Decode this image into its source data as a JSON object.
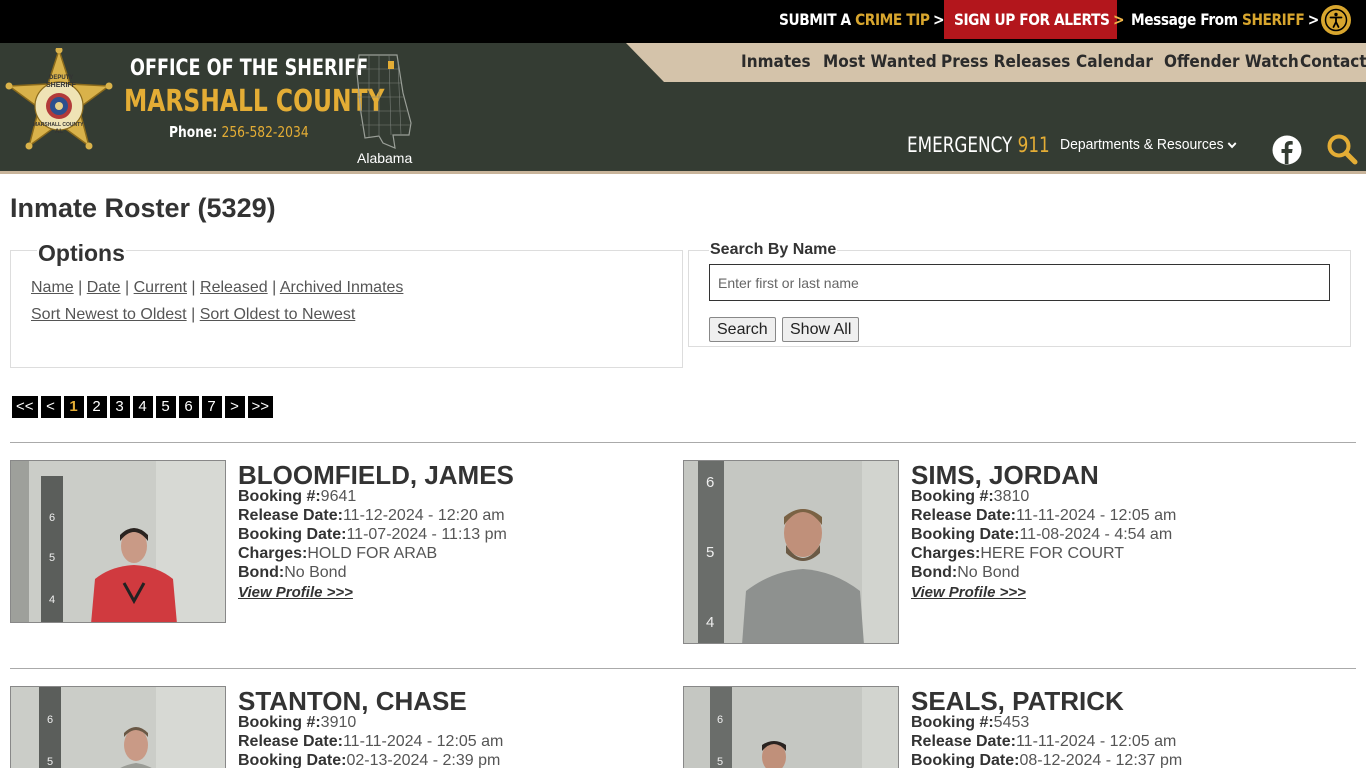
{
  "topbar": {
    "crime_prefix": "SUBMIT A",
    "crime_accent": "CRIME TIP",
    "alerts_label": "SIGN UP FOR ALERTS",
    "message_prefix": "Message From",
    "message_accent": "SHERIFF",
    "chevron": ">",
    "accessibility_icon": "accessibility-icon"
  },
  "header": {
    "office": "OFFICE OF THE SHERIFF",
    "county": "MARSHALL COUNTY",
    "phone_label": "Phone:",
    "phone_number": "256-582-2034",
    "state": "Alabama",
    "badge_text": [
      "DEPUTY",
      "SHERIFF",
      "MARSHALL COUNTY",
      "AL"
    ],
    "nav": [
      "Inmates",
      "Most Wanted",
      "Press Releases",
      "Calendar",
      "Offender Watch",
      "Contact"
    ],
    "emergency_label": "EMERGENCY",
    "emergency_number": "911",
    "departments": "Departments & Resources"
  },
  "page": {
    "title": "Inmate Roster (5329)"
  },
  "options": {
    "legend": "Options",
    "sort_links": [
      "Name",
      "Date",
      "Current",
      "Released",
      "Archived Inmates"
    ],
    "order_links": [
      "Sort Newest to Oldest",
      "Sort Oldest to Newest"
    ],
    "separator": "|"
  },
  "search": {
    "legend": "Search By Name",
    "placeholder": "Enter first or last name",
    "value": "",
    "search_button": "Search",
    "show_all_button": "Show All"
  },
  "pagination": {
    "pages": [
      "<<",
      "<",
      "1",
      "2",
      "3",
      "4",
      "5",
      "6",
      "7",
      ">",
      ">>"
    ],
    "current": "1"
  },
  "labels": {
    "booking_no": "Booking #:",
    "release_date": "Release Date:",
    "booking_date": "Booking Date:",
    "charges": "Charges:",
    "bond": "Bond:",
    "view_profile": "View Profile >>>"
  },
  "inmates": [
    {
      "name": "BLOOMFIELD, JAMES",
      "booking_no": "9641",
      "release_date": "11-12-2024 - 12:20 am",
      "booking_date": "11-07-2024 - 11:13 pm",
      "charges": "HOLD FOR ARAB",
      "bond": "No Bond",
      "shirt": "#d03a3f"
    },
    {
      "name": "SIMS, JORDAN",
      "booking_no": "3810",
      "release_date": "11-11-2024 - 12:05 am",
      "booking_date": "11-08-2024 - 4:54 am",
      "charges": "HERE FOR COURT",
      "bond": "No Bond",
      "shirt": "#8e918f"
    },
    {
      "name": "STANTON, CHASE",
      "booking_no": "3910",
      "release_date": "11-11-2024 - 12:05 am",
      "booking_date": "02-13-2024 - 2:39 pm",
      "charges": "",
      "bond": "",
      "shirt": "#9a9c96"
    },
    {
      "name": "SEALS, PATRICK",
      "booking_no": "5453",
      "release_date": "11-11-2024 - 12:05 am",
      "booking_date": "08-12-2024 - 12:37 pm",
      "charges": "",
      "bond": "",
      "shirt": "#8a8c88"
    }
  ],
  "colors": {
    "accent": "#e4ad35",
    "header": "#343c33",
    "nav": "#d4c3aa",
    "alerts": "#b3161c"
  }
}
